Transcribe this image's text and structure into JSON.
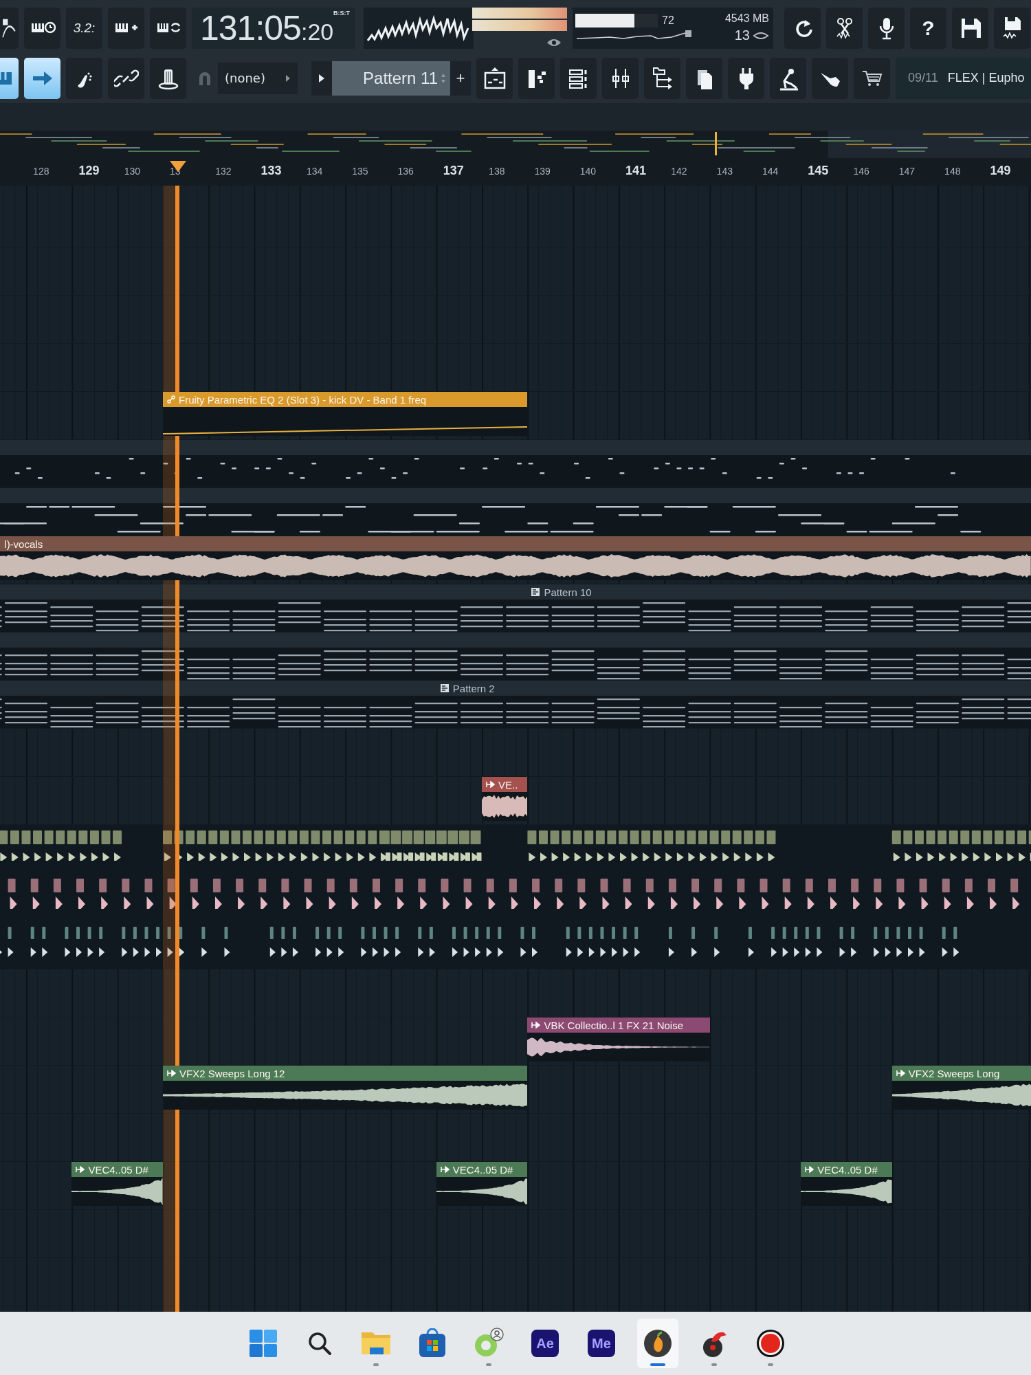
{
  "toolbar": {
    "row1_buttons": [
      {
        "kind": "icon"
      },
      {
        "kind": "icon"
      },
      {
        "kind": "text",
        "label": "3.2:"
      },
      {
        "kind": "icon"
      },
      {
        "kind": "icon"
      }
    ],
    "time": {
      "main": "131:05",
      "sub": ":20",
      "format": "B:S:T"
    },
    "peak_meter": [
      {
        "level": 1
      },
      {
        "level": 1
      }
    ],
    "cpu": {
      "value": "72",
      "level": 0.72
    },
    "memory": "4543 MB",
    "polyphony": "13",
    "right_buttons": [
      {
        "kind": "icon"
      },
      {
        "kind": "icon"
      },
      {
        "kind": "icon"
      },
      {
        "kind": "text",
        "label": "?"
      },
      {
        "kind": "icon"
      },
      {
        "kind": "icon"
      }
    ],
    "toggles": [
      {
        "selected": true
      },
      {
        "selected": true
      },
      {
        "selected": false
      },
      {
        "selected": false
      },
      {
        "selected": false
      }
    ],
    "snap": "(none)",
    "pattern": "Pattern 11",
    "add_label": "+",
    "hint": {
      "counter": "09/11",
      "text": "FLEX | Eupho"
    }
  },
  "ruler": [
    {
      "label": "128",
      "major": false
    },
    {
      "label": "129",
      "major": true
    },
    {
      "label": "130",
      "major": false
    },
    {
      "label": "13",
      "major": false
    },
    {
      "label": "132",
      "major": false
    },
    {
      "label": "133",
      "major": true
    },
    {
      "label": "134",
      "major": false
    },
    {
      "label": "135",
      "major": false
    },
    {
      "label": "136",
      "major": false
    },
    {
      "label": "137",
      "major": true
    },
    {
      "label": "138",
      "major": false
    },
    {
      "label": "139",
      "major": false
    },
    {
      "label": "140",
      "major": false
    },
    {
      "label": "141",
      "major": true
    },
    {
      "label": "142",
      "major": false
    },
    {
      "label": "143",
      "major": false
    },
    {
      "label": "144",
      "major": false
    },
    {
      "label": "145",
      "major": true
    },
    {
      "label": "146",
      "major": false
    },
    {
      "label": "147",
      "major": false
    },
    {
      "label": "148",
      "major": false
    },
    {
      "label": "149",
      "major": true
    }
  ],
  "playlist": {
    "tracks": [
      {
        "kind": "empty"
      },
      {
        "kind": "empty"
      },
      {
        "kind": "empty"
      },
      {
        "kind": "empty"
      },
      {
        "kind": "automation",
        "clips": [
          {
            "label": "Fruity Parametric EQ 2 (Slot 3) - kick DV - Band 1 freq",
            "color": "#d99a2b"
          }
        ]
      },
      {
        "kind": "melody"
      },
      {
        "kind": "bass"
      },
      {
        "kind": "audio",
        "clips": [
          {
            "label": "l)-vocals",
            "color": "#7b5448"
          }
        ]
      },
      {
        "kind": "chords",
        "clips": [
          {
            "label": "Pattern 10"
          }
        ]
      },
      {
        "kind": "chords"
      },
      {
        "kind": "chords",
        "clips": [
          {
            "label": "Pattern 2"
          }
        ]
      },
      {
        "kind": "empty"
      },
      {
        "kind": "audio",
        "clips": [
          {
            "label": "VE..",
            "color": "#a5524f"
          }
        ]
      },
      {
        "kind": "hats"
      },
      {
        "kind": "kicks"
      },
      {
        "kind": "snares"
      },
      {
        "kind": "empty"
      },
      {
        "kind": "audio",
        "clips": [
          {
            "label": "VBK Collectio..l 1 FX 21 Noise",
            "color": "#8c4a73"
          }
        ]
      },
      {
        "kind": "audio",
        "clips": [
          {
            "label": "VFX2 Sweeps Long 12",
            "color": "#4d7a56"
          },
          {
            "label": "VFX2 Sweeps Long",
            "color": "#4d7a56"
          }
        ]
      },
      {
        "kind": "empty"
      },
      {
        "kind": "audio",
        "clips": [
          {
            "label": "VEC4..05 D#",
            "color": "#4d7a56"
          },
          {
            "label": "VEC4..05 D#",
            "color": "#4d7a56"
          },
          {
            "label": "VEC4..05 D#",
            "color": "#4d7a56"
          }
        ]
      },
      {
        "kind": "empty"
      },
      {
        "kind": "empty"
      }
    ]
  },
  "taskbar": {
    "apps": [
      {
        "kind": "start",
        "selected": false,
        "running": false
      },
      {
        "kind": "search",
        "selected": false,
        "running": false
      },
      {
        "kind": "folder",
        "selected": false,
        "running": true
      },
      {
        "kind": "store",
        "selected": false,
        "running": false
      },
      {
        "kind": "ring",
        "selected": false,
        "running": true
      },
      {
        "kind": "tile",
        "label": "Ae",
        "selected": false,
        "running": false
      },
      {
        "kind": "tile",
        "label": "Me",
        "selected": false,
        "running": false
      },
      {
        "kind": "fruit",
        "selected": true,
        "running": true
      },
      {
        "kind": "bird",
        "selected": false,
        "running": true
      },
      {
        "kind": "record",
        "selected": false,
        "running": true
      }
    ]
  }
}
